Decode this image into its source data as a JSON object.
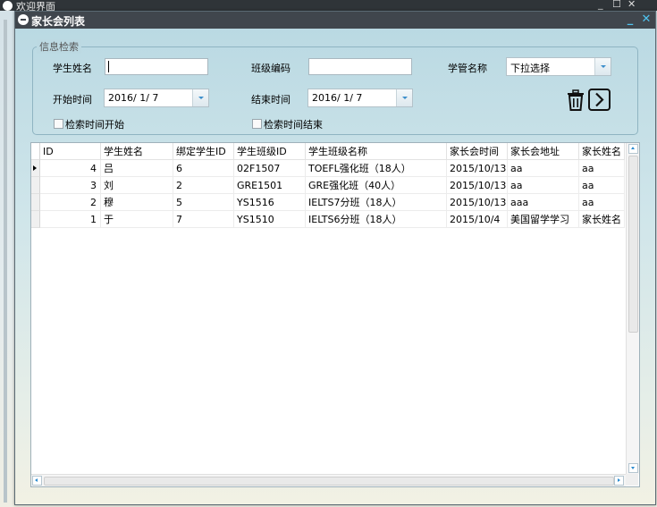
{
  "outer_window": {
    "title": "欢迎界面",
    "minimize": "_",
    "maximize": "☐",
    "close": "✕"
  },
  "window": {
    "title": "家长会列表",
    "minimize": "_",
    "close": "✕"
  },
  "search": {
    "group_title": "信息检索",
    "student_name_label": "学生姓名",
    "student_name_value": "",
    "class_code_label": "班级编码",
    "class_code_value": "",
    "manager_label": "学管名称",
    "manager_value": "下拉选择",
    "start_label": "开始时间",
    "start_value": "2016/  1/  7",
    "end_label": "结束时间",
    "end_value": "2016/  1/  7",
    "chk_start_label": "检索时间开始",
    "chk_end_label": "检索时间结束",
    "chk_start_checked": false,
    "chk_end_checked": false
  },
  "icons": {
    "delete": "trash-icon",
    "next": "chevron-right-icon",
    "window_logo": "app-logo-icon"
  },
  "colors": {
    "title_bar": "#40464d",
    "window_button": "#4fc3ef",
    "scroll_arrow": "#2c8bd0"
  },
  "table": {
    "columns": [
      "ID",
      "学生姓名",
      "绑定学生ID",
      "学生班级ID",
      "学生班级名称",
      "家长会时间",
      "家长会地址",
      "家长姓名"
    ],
    "rows": [
      [
        "4",
        "吕",
        "6",
        "02F1507",
        "TOEFL强化班（18人）",
        "2015/10/13",
        "aa",
        "aa"
      ],
      [
        "3",
        "刘",
        "2",
        "GRE1501",
        "GRE强化班（40人）",
        "2015/10/13",
        "aa",
        "aa"
      ],
      [
        "2",
        "穆",
        "5",
        "YS1516",
        "IELTS7分班（18人）",
        "2015/10/13",
        "aaa",
        "aa"
      ],
      [
        "1",
        "于",
        "7",
        "YS1510",
        "IELTS6分班（18人）",
        "2015/10/4",
        "美国留学学习",
        "家长姓名"
      ]
    ],
    "selected_row": 0
  }
}
